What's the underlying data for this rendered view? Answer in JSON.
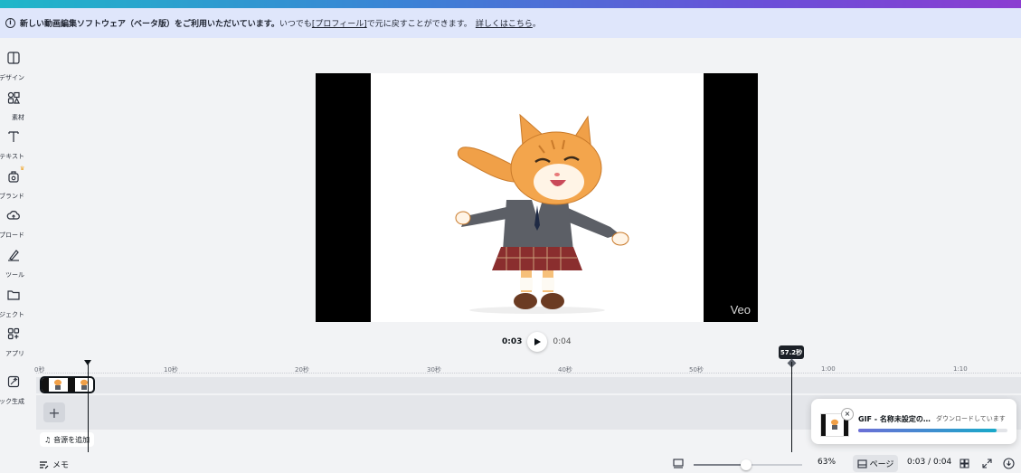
{
  "banner": {
    "message_bold": "新しい動画編集ソフトウェア（ベータ版）をご利用いただいています。",
    "message_pre": "いつでも",
    "profile_link": "[プロフィール]",
    "message_post": "で元に戻すことができます。",
    "details_link": "詳しくはこちら",
    "period": "。"
  },
  "sidebar": {
    "items": [
      {
        "label": "デザイン",
        "icon": "layout-icon"
      },
      {
        "label": "素材",
        "icon": "elements-icon"
      },
      {
        "label": "テキスト",
        "icon": "text-icon"
      },
      {
        "label": "ブランド",
        "icon": "brand-icon"
      },
      {
        "label": "ップロード",
        "icon": "upload-icon"
      },
      {
        "label": "ツール",
        "icon": "draw-icon"
      },
      {
        "label": "ロジェクト",
        "icon": "folder-icon"
      },
      {
        "label": "アプリ",
        "icon": "apps-icon"
      },
      {
        "label": "ジック生成",
        "icon": "magic-icon"
      }
    ]
  },
  "canvas": {
    "watermark": "Veo"
  },
  "player": {
    "current_time": "0:03",
    "duration": "0:04"
  },
  "timeline": {
    "ticks": [
      "0秒",
      "10秒",
      "20秒",
      "30秒",
      "40秒",
      "50秒",
      "1:00",
      "1:10"
    ],
    "marker_label": "57.2秒",
    "add_audio": "音源を追加",
    "add_label": "+"
  },
  "toast": {
    "title": "GIF - 名称未設定の...",
    "status": "ダウンロードしています",
    "close": "×",
    "progress": 0.93
  },
  "bottom": {
    "memo": "メモ",
    "zoom": "63%",
    "zoom_level": 0.48,
    "page": "ページ",
    "time": "0:03 / 0:04"
  },
  "colors": {
    "accent_gradient_start": "#1fb7c9",
    "accent_gradient_end": "#8b3dd1",
    "banner_bg": "#dfe6fb"
  }
}
